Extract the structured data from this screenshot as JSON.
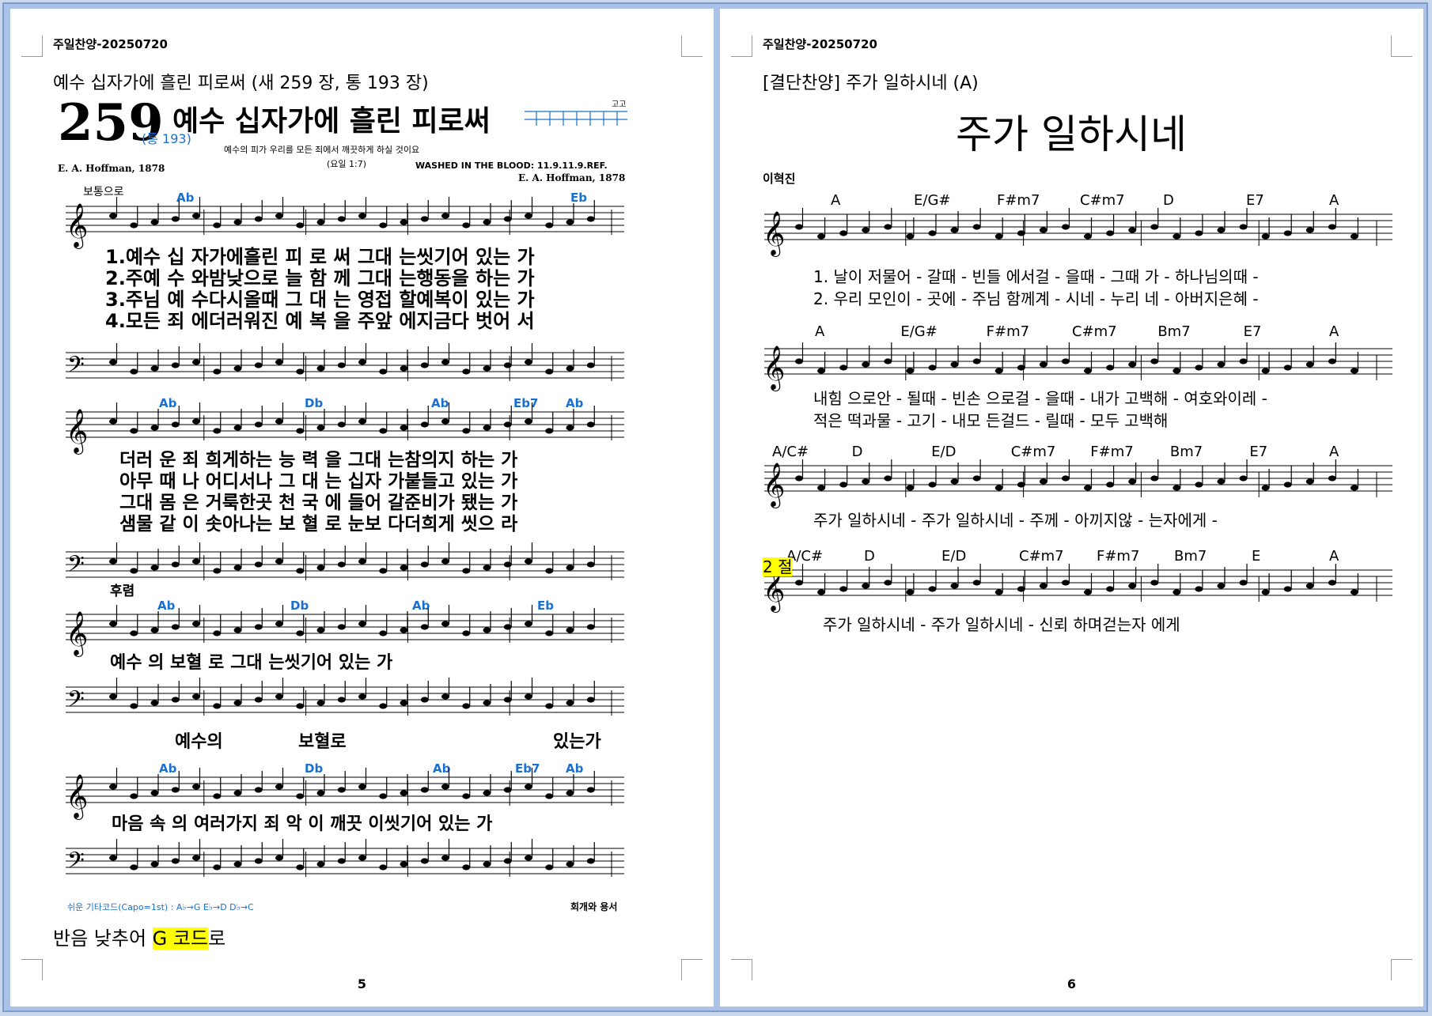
{
  "left": {
    "header": "주일찬양-20250720",
    "song_line": "예수 십자가에 흘린 피로써 (새 259 장, 통 193 장)",
    "hymn": {
      "number": "259",
      "alt_number": "(통 193)",
      "title": "예수 십자가에 흘린 피로써",
      "subtitle": "예수의 피가 우리를 모든 죄에서 깨끗하게 하실 것이요",
      "reference": "(요일 1:7)",
      "tune": "WASHED IN THE BLOOD: 11.9.11.9.REF.",
      "composer_left": "E. A. Hoffman, 1878",
      "composer_right": "E. A. Hoffman, 1878",
      "tempo": "보통으로",
      "tempo_small": "고고",
      "system1_chords": [
        "Ab",
        "Eb"
      ],
      "verses1": [
        "1.예수 십 자가에흘린 피 로 써 그대 는씻기어 있는 가",
        "2.주예 수 와밤낮으로 늘 함 께 그대 는행동을 하는 가",
        "3.주님 예 수다시올때 그 대 는 영접 할예복이 있는 가",
        "4.모든 죄 에더러워진 예 복 을 주앞 에지금다 벗어 서"
      ],
      "system2_chords": [
        "Ab",
        "Db",
        "Ab",
        "Eb7",
        "Ab"
      ],
      "verses2": [
        "더러 운 죄 희게하는 능 력 을 그대 는참의지 하는 가",
        "아무 때 나 어디서나 그 대 는 십자 가붙들고 있는 가",
        "그대 몸 은 거룩한곳 천 국 에 들어 갈준비가 됐는 가",
        "샘물 같 이 솟아나는 보 혈 로 눈보 다더희게 씻으 라"
      ],
      "refrain_label": "후렴",
      "system3_chords": [
        "Ab",
        "Db",
        "Ab",
        "Eb"
      ],
      "refrain_lyric": "예수 의 보혈 로 그대 는씻기어 있는 가",
      "bass_lyric_1": "예수의",
      "bass_lyric_2": "보혈로",
      "bass_lyric_3": "있는가",
      "system4_chords": [
        "Ab",
        "Db",
        "Ab",
        "Eb7",
        "Ab"
      ],
      "final_lyric": "마음 속 의 여러가지 죄 악 이 깨끗 이씻기어 있는 가",
      "guitar_note": "쉬운 기타코드(Capo=1st) : A♭→G  E♭→D  D♭→C",
      "category": "회개와 용서"
    },
    "note_before": "반음 낮추어 ",
    "note_highlight": "G 코드",
    "note_after": "로",
    "page_number": "5"
  },
  "right": {
    "header": "주일찬양-20250720",
    "song_line": "[결단찬양] 주가 일하시네 (A)",
    "title": "주가 일하시네",
    "composer": "이혁진",
    "row1_chords": [
      "A",
      "E/G#",
      "F#m7",
      "C#m7",
      "D",
      "E7",
      "A"
    ],
    "row1_lyrics": [
      "1. 날이 저물어 - 갈때 - 빈들 에서걸 - 을때 - 그때 가 - 하나님의때   -",
      "2. 우리 모인이 - 곳에 - 주님 함께계 - 시네 - 누리 네 - 아버지은혜   -"
    ],
    "row2_chords": [
      "A",
      "E/G#",
      "F#m7",
      "C#m7",
      "Bm7",
      "E7",
      "A"
    ],
    "row2_lyrics": [
      "내힘 으로안 - 될때 - 빈손 으로걸 - 을때 - 내가 고백해 - 여호와이레  -",
      "적은 떡과물 - 고기 - 내모 든걸드 - 릴때 - 모두 고백해"
    ],
    "row3_chords": [
      "A/C#",
      "D",
      "E/D",
      "C#m7",
      "F#m7",
      "Bm7",
      "E7",
      "A"
    ],
    "row3_lyrics": "주가  일하시네 - 주가 일하시네 - 주께   - 아끼지않 - 는자에게    -",
    "row4_chords": [
      "A/C#",
      "D",
      "E/D",
      "C#m7",
      "F#m7",
      "Bm7",
      "E",
      "A"
    ],
    "row4_lyrics": "주가  일하시네  -  주가  일하시네  -  신뢰  하며걷는자  에게",
    "verse_label": "2 절",
    "page_number": "6"
  },
  "colors": {
    "chord_blue": "#1a6fd1",
    "highlight": "#ffff00",
    "frame_bg": "#aac2e6"
  }
}
